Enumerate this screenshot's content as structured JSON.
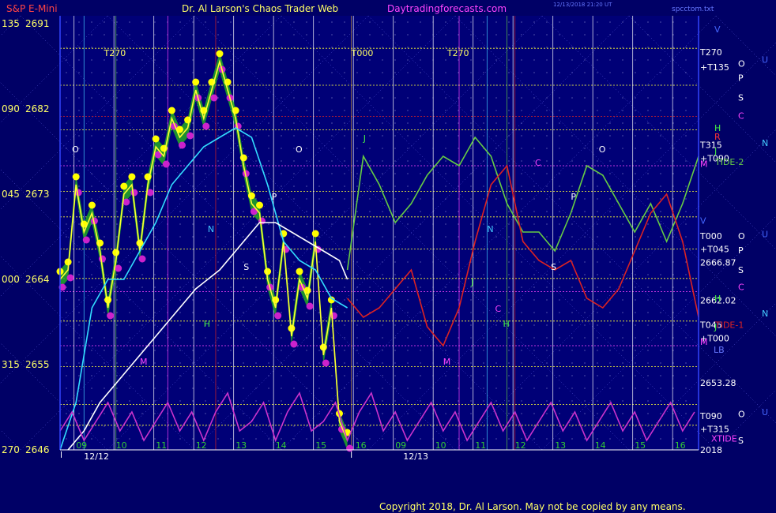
{
  "header": {
    "left_label": "S&P E-Mini",
    "center_title": "Dr. Al Larson's Chaos Trader Web",
    "site": "Daytradingforecasts.com",
    "stamp_line1": "12/13/2018 21:20 UT",
    "stamp_line2": "",
    "file_label": "spcctom.txt"
  },
  "copyright": "Copyright 2018, Dr. Al Larson. May not be copied by any means.",
  "chart_data": {
    "type": "line",
    "title": "S&P E-Mini",
    "ylim": [
      2646,
      2691
    ],
    "y_ticks": [
      {
        "angle": "135",
        "price": "2691",
        "value": 2691
      },
      {
        "angle": "090",
        "price": "2682",
        "value": 2682
      },
      {
        "angle": "045",
        "price": "2673",
        "value": 2673
      },
      {
        "angle": "000",
        "price": "2664",
        "value": 2664
      },
      {
        "angle": "315",
        "price": "2655",
        "value": 2655
      },
      {
        "angle": "270",
        "price": "2646",
        "value": 2646
      }
    ],
    "x_hour_labels": [
      {
        "label": "09",
        "x": 0.4
      },
      {
        "label": "10",
        "x": 1.4
      },
      {
        "label": "11",
        "x": 2.4
      },
      {
        "label": "12",
        "x": 3.4
      },
      {
        "label": "13",
        "x": 4.4
      },
      {
        "label": "14",
        "x": 5.4
      },
      {
        "label": "15",
        "x": 6.4
      },
      {
        "label": "16",
        "x": 7.4
      },
      {
        "label": "09",
        "x": 8.4
      },
      {
        "label": "10",
        "x": 9.4
      },
      {
        "label": "11",
        "x": 10.4
      },
      {
        "label": "12",
        "x": 11.4
      },
      {
        "label": "13",
        "x": 12.4
      },
      {
        "label": "14",
        "x": 13.4
      },
      {
        "label": "15",
        "x": 14.4
      },
      {
        "label": "16",
        "x": 15.4
      }
    ],
    "x_dates": [
      {
        "label": "12/12",
        "x": 0.6
      },
      {
        "label": "12/13",
        "x": 8.6
      }
    ],
    "xlim": [
      0,
      16
    ],
    "series": [
      {
        "name": "",
        "color": "#ffff33",
        "x": [
          0.0,
          0.2,
          0.4,
          0.6,
          0.8,
          1.0,
          1.2,
          1.4,
          1.6,
          1.8,
          2.0,
          2.2,
          2.4,
          2.6,
          2.8,
          3.0,
          3.2,
          3.4,
          3.6,
          3.8,
          4.0,
          4.2,
          4.4,
          4.6,
          4.8,
          5.0,
          5.2,
          5.4,
          5.6,
          5.8,
          6.0,
          6.2,
          6.4,
          6.6,
          6.8,
          7.0,
          7.2
        ],
        "y": [
          2664,
          2665,
          2674,
          2669,
          2671,
          2667,
          2661,
          2666,
          2673,
          2674,
          2667,
          2674,
          2678,
          2677,
          2681,
          2679,
          2680,
          2684,
          2681,
          2684,
          2687,
          2684,
          2681,
          2676,
          2672,
          2671,
          2664,
          2661,
          2668,
          2658,
          2664,
          2662,
          2668,
          2656,
          2661,
          2649,
          2647
        ]
      },
      {
        "name": "",
        "color": "#33ddff",
        "x": [
          0.0,
          0.4,
          0.8,
          1.2,
          1.6,
          2.0,
          2.4,
          2.8,
          3.2,
          3.6,
          4.0,
          4.4,
          4.8,
          5.2,
          5.6,
          6.0,
          6.4,
          6.8,
          7.2
        ],
        "y": [
          2646,
          2651,
          2661,
          2664,
          2664,
          2667,
          2670,
          2674,
          2676,
          2678,
          2679,
          2680,
          2679,
          2674,
          2668,
          2666,
          2665,
          2662,
          2661
        ]
      },
      {
        "name": "",
        "color": "#ffffff",
        "x": [
          0.2,
          0.6,
          1.0,
          1.6,
          2.2,
          2.8,
          3.4,
          4.0,
          4.6,
          5.0,
          5.4,
          5.8,
          6.2,
          6.6,
          7.0,
          7.2
        ],
        "y": [
          2646,
          2648,
          2651,
          2654,
          2657,
          2660,
          2663,
          2665,
          2668,
          2670,
          2670,
          2669,
          2668,
          2667,
          2666,
          2664
        ]
      },
      {
        "name": "",
        "color": "#66cc44",
        "x": [
          7.2,
          7.6,
          8.0,
          8.4,
          8.8,
          9.2,
          9.6,
          10.0,
          10.4,
          10.8,
          11.2,
          11.6,
          12.0,
          12.4,
          12.8,
          13.2,
          13.6,
          14.0,
          14.4,
          14.8,
          15.2,
          15.6,
          16.0
        ],
        "y": [
          2665,
          2677,
          2674,
          2670,
          2672,
          2675,
          2677,
          2676,
          2679,
          2677,
          2672,
          2669,
          2669,
          2667,
          2671,
          2676,
          2675,
          2672,
          2669,
          2672,
          2668,
          2672,
          2677
        ]
      },
      {
        "name": "",
        "color": "#dd2222",
        "x": [
          7.2,
          7.6,
          8.0,
          8.4,
          8.8,
          9.2,
          9.6,
          10.0,
          10.4,
          10.8,
          11.2,
          11.6,
          12.0,
          12.4,
          12.8,
          13.2,
          13.6,
          14.0,
          14.4,
          14.8,
          15.2,
          15.6,
          16.0
        ],
        "y": [
          2662,
          2660,
          2661,
          2663,
          2665,
          2659,
          2657,
          2661,
          2668,
          2674,
          2676,
          2668,
          2666,
          2665,
          2666,
          2662,
          2661,
          2663,
          2667,
          2671,
          2673,
          2668,
          2660
        ]
      },
      {
        "name": "",
        "color": "#cc33cc",
        "x": [
          0.0,
          0.3,
          0.6,
          0.9,
          1.2,
          1.5,
          1.8,
          2.1,
          2.4,
          2.7,
          3.0,
          3.3,
          3.6,
          3.9,
          4.2,
          4.5,
          4.8,
          5.1,
          5.4,
          5.7,
          6.0,
          6.3,
          6.6,
          6.9,
          7.2,
          7.5,
          7.8,
          8.1,
          8.4,
          8.7,
          9.0,
          9.3,
          9.6,
          9.9,
          10.2,
          10.5,
          10.8,
          11.1,
          11.4,
          11.7,
          12.0,
          12.3,
          12.6,
          12.9,
          13.2,
          13.5,
          13.8,
          14.1,
          14.4,
          14.7,
          15.0,
          15.3,
          15.6,
          15.9
        ],
        "y": [
          2648,
          2650,
          2647,
          2649,
          2651,
          2648,
          2650,
          2647,
          2649,
          2651,
          2648,
          2650,
          2647,
          2650,
          2652,
          2648,
          2649,
          2651,
          2647,
          2650,
          2652,
          2648,
          2649,
          2651,
          2647,
          2650,
          2652,
          2648,
          2650,
          2647,
          2649,
          2651,
          2648,
          2650,
          2647,
          2649,
          2651,
          2648,
          2650,
          2647,
          2649,
          2651,
          2648,
          2650,
          2647,
          2649,
          2651,
          2648,
          2650,
          2647,
          2649,
          2651,
          2648,
          2650
        ]
      }
    ],
    "right_labels": [
      {
        "text": "T270",
        "color": "#ffffff",
        "y": 2688.0
      },
      {
        "text": "+T135",
        "color": "#ffffff",
        "y": 2686.4
      },
      {
        "text": "T315",
        "color": "#ffffff",
        "y": 2678.2
      },
      {
        "text": "+T090",
        "color": "#ffffff",
        "y": 2676.8
      },
      {
        "text": "T000",
        "color": "#ffffff",
        "y": 2668.6
      },
      {
        "text": "+T045",
        "color": "#ffffff",
        "y": 2667.2
      },
      {
        "text": "2666.87",
        "color": "#ffffff",
        "y": 2665.8
      },
      {
        "text": "2662.02",
        "color": "#ffffff",
        "y": 2661.8
      },
      {
        "text": "T045",
        "color": "#ffffff",
        "y": 2659.2
      },
      {
        "text": "+T000",
        "color": "#ffffff",
        "y": 2657.8
      },
      {
        "text": "2653.28",
        "color": "#ffffff",
        "y": 2653.1
      },
      {
        "text": "T090",
        "color": "#ffffff",
        "y": 2649.6
      },
      {
        "text": "+T315",
        "color": "#ffffff",
        "y": 2648.2
      },
      {
        "text": "2018",
        "color": "#ffffff",
        "y": 2646.0
      },
      {
        "text": "XTIDE",
        "color": "#ff44ff",
        "y": 2647.2
      },
      {
        "text": "TIDE-2",
        "color": "#66cc44",
        "y": 2676.4
      },
      {
        "text": "TIDE-1",
        "color": "#dd2222",
        "y": 2659.2
      },
      {
        "text": "LB",
        "color": "#6677ff",
        "y": 2656.6
      }
    ],
    "planet_labels": [
      {
        "text": "V",
        "color": "#4466ff",
        "y": 2690.4
      },
      {
        "text": "O",
        "color": "#ffffff",
        "y": 2686.8,
        "col": 2
      },
      {
        "text": "U",
        "color": "#4466ff",
        "y": 2687.2,
        "col": 3
      },
      {
        "text": "P",
        "color": "#ffffff",
        "y": 2685.3,
        "col": 2
      },
      {
        "text": "S",
        "color": "#ffffff",
        "y": 2683.2,
        "col": 2
      },
      {
        "text": "C",
        "color": "#ff44ff",
        "y": 2681.3,
        "col": 2
      },
      {
        "text": "H",
        "color": "#44ee44",
        "y": 2680.0,
        "col": 1
      },
      {
        "text": "R",
        "color": "#ff3333",
        "y": 2679.1,
        "col": 1
      },
      {
        "text": "N",
        "color": "#44ccff",
        "y": 2678.4,
        "col": 3
      },
      {
        "text": "J",
        "color": "#44ee44",
        "y": 2677.6,
        "col": 1
      },
      {
        "text": "M",
        "color": "#ff44ff",
        "y": 2676.2,
        "col": 0
      },
      {
        "text": "V",
        "color": "#4466ff",
        "y": 2670.2,
        "col": 0
      },
      {
        "text": "O",
        "color": "#ffffff",
        "y": 2668.6,
        "col": 2
      },
      {
        "text": "U",
        "color": "#4466ff",
        "y": 2668.8,
        "col": 3
      },
      {
        "text": "P",
        "color": "#ffffff",
        "y": 2667.1,
        "col": 2
      },
      {
        "text": "S",
        "color": "#ffffff",
        "y": 2665.0,
        "col": 2
      },
      {
        "text": "C",
        "color": "#ff44ff",
        "y": 2663.2,
        "col": 2
      },
      {
        "text": "H",
        "color": "#44ee44",
        "y": 2662.0,
        "col": 1
      },
      {
        "text": "N",
        "color": "#44ccff",
        "y": 2660.4,
        "col": 3
      },
      {
        "text": "J",
        "color": "#44ee44",
        "y": 2659.0,
        "col": 1
      },
      {
        "text": "M",
        "color": "#ff44ff",
        "y": 2657.4,
        "col": 0
      },
      {
        "text": "O",
        "color": "#ffffff",
        "y": 2649.8,
        "col": 2
      },
      {
        "text": "U",
        "color": "#4466ff",
        "y": 2650.0,
        "col": 3
      },
      {
        "text": "S",
        "color": "#ffffff",
        "y": 2647.0,
        "col": 2
      }
    ],
    "in_chart_labels": [
      {
        "text": "T270",
        "color": "#ffff66",
        "x": 1.1,
        "y": 2687.6
      },
      {
        "text": "T000",
        "color": "#ffff66",
        "x": 7.3,
        "y": 2687.6
      },
      {
        "text": "T270",
        "color": "#ffff66",
        "x": 9.7,
        "y": 2687.6
      },
      {
        "text": "O",
        "color": "#ffffff",
        "x": 0.3,
        "y": 2677.4
      },
      {
        "text": "O",
        "color": "#ffffff",
        "x": 5.9,
        "y": 2677.4
      },
      {
        "text": "O",
        "color": "#ffffff",
        "x": 13.5,
        "y": 2677.4
      },
      {
        "text": "P",
        "color": "#ffffff",
        "x": 5.3,
        "y": 2672.4
      },
      {
        "text": "P",
        "color": "#ffffff",
        "x": 12.8,
        "y": 2672.4
      },
      {
        "text": "N",
        "color": "#44ccff",
        "x": 3.7,
        "y": 2669.0
      },
      {
        "text": "N",
        "color": "#44ccff",
        "x": 10.7,
        "y": 2669.0
      },
      {
        "text": "S",
        "color": "#ffffff",
        "x": 4.6,
        "y": 2665.0
      },
      {
        "text": "S",
        "color": "#ffffff",
        "x": 12.3,
        "y": 2665.0
      },
      {
        "text": "H",
        "color": "#44ee44",
        "x": 3.6,
        "y": 2659.0
      },
      {
        "text": "H",
        "color": "#44ee44",
        "x": 11.1,
        "y": 2659.0
      },
      {
        "text": "M",
        "color": "#ff44ff",
        "x": 2.0,
        "y": 2655.0
      },
      {
        "text": "M",
        "color": "#ff44ff",
        "x": 9.6,
        "y": 2655.0
      },
      {
        "text": "C",
        "color": "#ff44ff",
        "x": 11.9,
        "y": 2676.0
      },
      {
        "text": "C",
        "color": "#ff44ff",
        "x": 10.9,
        "y": 2660.6
      },
      {
        "text": "J",
        "color": "#44ee44",
        "x": 7.6,
        "y": 2678.6
      },
      {
        "text": "J",
        "color": "#44ee44",
        "x": 10.3,
        "y": 2663.4
      }
    ],
    "vertical_lines": [
      {
        "x": 0.35,
        "color": "#ffffff"
      },
      {
        "x": 1.35,
        "color": "#ffffff"
      },
      {
        "x": 2.35,
        "color": "#ffffff"
      },
      {
        "x": 3.35,
        "color": "#ffffff"
      },
      {
        "x": 4.35,
        "color": "#ffffff"
      },
      {
        "x": 5.35,
        "color": "#ffffff"
      },
      {
        "x": 6.35,
        "color": "#ffffff"
      },
      {
        "x": 7.35,
        "color": "#ffffff"
      },
      {
        "x": 8.35,
        "color": "#ffffff"
      },
      {
        "x": 9.35,
        "color": "#ffffff"
      },
      {
        "x": 10.35,
        "color": "#ffffff"
      },
      {
        "x": 11.35,
        "color": "#ffffff"
      },
      {
        "x": 12.35,
        "color": "#ffffff"
      },
      {
        "x": 13.35,
        "color": "#ffffff"
      },
      {
        "x": 14.35,
        "color": "#ffffff"
      },
      {
        "x": 15.35,
        "color": "#ffffff"
      },
      {
        "x": 3.9,
        "color": "#dd2222"
      },
      {
        "x": 11.4,
        "color": "#dd2222"
      },
      {
        "x": 2.7,
        "color": "#ff44ff"
      },
      {
        "x": 10.0,
        "color": "#ff44ff"
      },
      {
        "x": 1.4,
        "color": "#66cc44"
      },
      {
        "x": 11.2,
        "color": "#66cc44"
      },
      {
        "x": 0.6,
        "color": "#44ccff"
      },
      {
        "x": 10.7,
        "color": "#44ccff"
      },
      {
        "x": 7.3,
        "color": "#cc9933"
      }
    ],
    "horizontal_lines": [
      {
        "y": 2688.4,
        "color": "#ffff33"
      },
      {
        "y": 2684.5,
        "color": "#ffff33"
      },
      {
        "y": 2681.2,
        "color": "#dd2222"
      },
      {
        "y": 2679.8,
        "color": "#ffff33"
      },
      {
        "y": 2676.0,
        "color": "#ff44ff"
      },
      {
        "y": 2673.3,
        "color": "#ffff33"
      },
      {
        "y": 2670.6,
        "color": "#ffff33"
      },
      {
        "y": 2667.2,
        "color": "#ffff33"
      },
      {
        "y": 2664.1,
        "color": "#ffff33"
      },
      {
        "y": 2662.7,
        "color": "#ff44ff"
      },
      {
        "y": 2659.6,
        "color": "#ffff33"
      },
      {
        "y": 2657.0,
        "color": "#ff44ff"
      },
      {
        "y": 2654.8,
        "color": "#ffff33"
      },
      {
        "y": 2650.8,
        "color": "#ffff33"
      },
      {
        "y": 2648.6,
        "color": "#ffff33"
      }
    ]
  }
}
